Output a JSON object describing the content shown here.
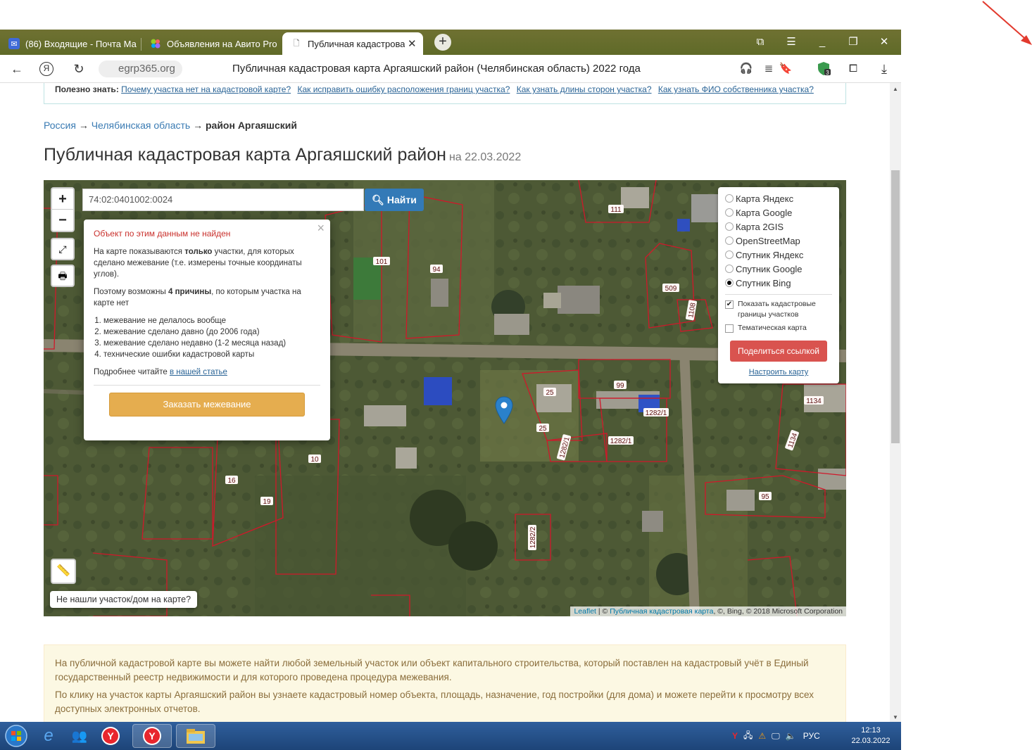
{
  "browser": {
    "tabs": [
      {
        "label": "(86) Входящие - Почта Ма",
        "icon": "mail-icon"
      },
      {
        "label": "Объявления на Авито Pro",
        "icon": "avito-icon"
      },
      {
        "label": "Публичная кадастрова",
        "icon": "document-icon",
        "active": true
      }
    ],
    "url": "egrp365.org",
    "page_title": "Публичная кадастровая карта Аргаяшский район (Челябинская область) 2022 года"
  },
  "page": {
    "info_prefix": "Полезно знать:",
    "info_links": [
      "Почему участка нет на кадастровой карте?",
      "Как исправить ошибку расположения границ участка?",
      "Как узнать длины сторон участка?",
      "Как узнать ФИО собственника участка?"
    ],
    "breadcrumb": {
      "country": "Россия",
      "arrow": "→",
      "region": "Челябинская область",
      "district": "район Аргаяшский"
    },
    "heading": "Публичная кадастровая карта Аргаяшский район",
    "heading_date": "на 22.03.2022"
  },
  "map": {
    "zoom_in": "+",
    "zoom_out": "−",
    "search_value": "74:02:0401002:0024",
    "search_button": "Найти",
    "popup": {
      "error": "Объект по этим данным не найден",
      "p1_a": "На карте показываются ",
      "p1_b": "только",
      "p1_c": " участки, для которых сделано межевание (т.е. измерены точные координаты углов).",
      "p2_a": "Поэтому возможны ",
      "p2_b": "4 причины",
      "p2_c": ", по которым участка на карте нет",
      "reasons": [
        "межевание не делалось вообще",
        "межевание сделано давно (до 2006 года)",
        "межевание сделано недавно (1-2 месяца назад)",
        "технические ошибки кадастровой карты"
      ],
      "more_text": "Подробнее читайте ",
      "more_link": "в нашей статье",
      "order_button": "Заказать межевание",
      "close": "×"
    },
    "layers": {
      "options": [
        "Карта Яндекс",
        "Карта Google",
        "Карта 2GIS",
        "OpenStreetMap",
        "Спутник Яндекс",
        "Спутник Google",
        "Спутник Bing"
      ],
      "selected": "Спутник Bing",
      "show_borders": "Показать кадастровые границы участков",
      "show_borders_checked": true,
      "thematic": "Тематическая карта",
      "thematic_checked": false,
      "share_button": "Поделиться ссылкой",
      "configure_link": "Настроить карту"
    },
    "parcel_labels": [
      "111",
      "101",
      "94",
      "509",
      "1108",
      "25",
      "99",
      "1282/1",
      "25",
      "1282/1",
      "1282/1",
      "1134",
      "1134",
      "10",
      "16",
      "19",
      "95",
      "1282/2",
      "1282/2"
    ],
    "not_found_button": "Не нашли участок/дом на карте?",
    "attribution_leaflet": "Leaflet",
    "attribution_sep": " | © ",
    "attribution_link": "Публичная кадастровая карта",
    "attribution_rest": ", ©, Bing, © 2018 Microsoft Corporation",
    "colors": {
      "parcel_border": "#d0182a",
      "marker": "#2a81cb"
    }
  },
  "bottom_info": {
    "p1": "На публичной кадастровой карте вы можете найти любой земельный участок или объект капитального строительства, который поставлен на кадастровый учёт в Единый государственный реестр недвижимости и для которого проведена процедура межевания.",
    "p2": "По клику на участок карты Аргаяшский район вы узнаете кадастровый номер объекта, площадь, назначение, год постройки (для дома) и можете перейти к просмотру всех доступных электронных отчетов."
  },
  "taskbar": {
    "lang": "РУС",
    "time": "12:13",
    "date": "22.03.2022"
  }
}
